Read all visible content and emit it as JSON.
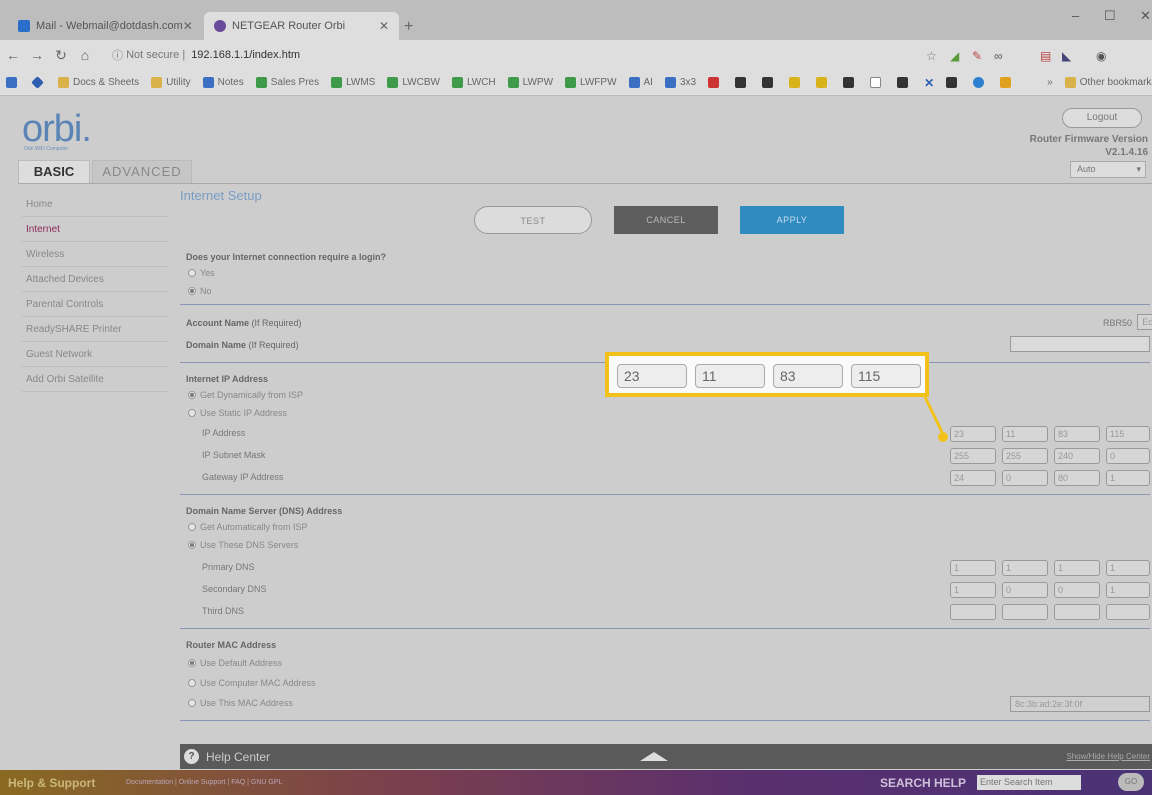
{
  "browser": {
    "tabs": [
      {
        "label": "Mail - Webmail@dotdash.com"
      },
      {
        "label": "NETGEAR Router Orbi"
      }
    ],
    "new_tab": "+",
    "window_controls": [
      "–",
      "☐",
      "✕"
    ],
    "url_prefix": "Not secure",
    "url": "192.168.1.1/index.htm",
    "bookmarks": [
      {
        "label": "Docs & Sheets",
        "color": "#d9b24a"
      },
      {
        "label": "Utility",
        "color": "#d9b24a"
      },
      {
        "label": "Notes",
        "color": "#3a6fc4"
      },
      {
        "label": "Sales Pres",
        "color": "#3f9a4a"
      },
      {
        "label": "LWMS",
        "color": "#3f9a4a"
      },
      {
        "label": "LWCBW",
        "color": "#3f9a4a"
      },
      {
        "label": "LWCH",
        "color": "#3f9a4a"
      },
      {
        "label": "LWPW",
        "color": "#3f9a4a"
      },
      {
        "label": "LWFPW",
        "color": "#3f9a4a"
      },
      {
        "label": "AI",
        "color": "#3a6fc4"
      },
      {
        "label": "3x3",
        "color": "#3a6fc4"
      }
    ],
    "other_bookmarks": "Other bookmarks"
  },
  "header": {
    "logo": "orbi.",
    "logo_sub": "Orbi WiFi Computer",
    "logout_label": "Logout",
    "firmware_label": "Router Firmware Version",
    "firmware_version": "V2.1.4.16",
    "language": "Auto",
    "tab_basic": "BASIC",
    "tab_advanced": "ADVANCED"
  },
  "sidebar": {
    "items": [
      {
        "label": "Home"
      },
      {
        "label": "Internet"
      },
      {
        "label": "Wireless"
      },
      {
        "label": "Attached Devices"
      },
      {
        "label": "Parental Controls"
      },
      {
        "label": "ReadySHARE Printer"
      },
      {
        "label": "Guest Network"
      },
      {
        "label": "Add Orbi Satellite"
      }
    ]
  },
  "main": {
    "title": "Internet Setup",
    "btn_test": "TEST",
    "btn_cancel": "CANCEL",
    "btn_apply": "APPLY",
    "login_question": "Does your Internet connection require a login?",
    "login_yes": "Yes",
    "login_no": "No",
    "account_name_label": "Account Name",
    "account_name_hint": "(If Required)",
    "account_name_value": "RBR50",
    "edit_label": "Edit",
    "domain_name_label": "Domain Name",
    "domain_name_hint": "(If Required)",
    "ip_section": "Internet IP Address",
    "ip_dynamic": "Get Dynamically from ISP",
    "ip_static": "Use Static IP Address",
    "ip_address_label": "IP Address",
    "subnet_label": "IP Subnet Mask",
    "gateway_label": "Gateway IP Address",
    "ip_address": [
      "23",
      "11",
      "83",
      "115"
    ],
    "subnet_mask": [
      "255",
      "255",
      "240",
      "0"
    ],
    "gateway": [
      "24",
      "0",
      "80",
      "1"
    ],
    "dns_section": "Domain Name Server (DNS) Address",
    "dns_auto": "Get Automatically from ISP",
    "dns_manual": "Use These DNS Servers",
    "primary_dns_label": "Primary DNS",
    "secondary_dns_label": "Secondary DNS",
    "third_dns_label": "Third DNS",
    "primary_dns": [
      "1",
      "1",
      "1",
      "1"
    ],
    "secondary_dns": [
      "1",
      "0",
      "0",
      "1"
    ],
    "third_dns": [
      "",
      "",
      "",
      ""
    ],
    "mac_section": "Router MAC Address",
    "mac_default": "Use Default Address",
    "mac_computer": "Use Computer MAC Address",
    "mac_this": "Use This MAC Address",
    "mac_value": "8c:3b:ad:2e:3f:0f"
  },
  "callout": {
    "values": [
      "23",
      "11",
      "83",
      "115"
    ],
    "color": "#f2c21b"
  },
  "help": {
    "icon": "?",
    "title": "Help Center",
    "toggle": "Show/Hide Help Center"
  },
  "support": {
    "title": "Help & Support",
    "links": "Documentation | Online Support | FAQ | GNU GPL",
    "search_label": "SEARCH HELP",
    "search_placeholder": "Enter Search Item",
    "go": "GO"
  }
}
